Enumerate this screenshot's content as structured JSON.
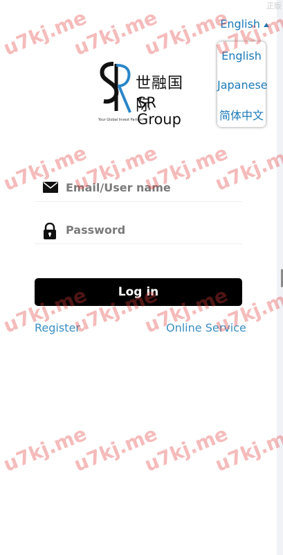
{
  "corner": {
    "text": "正版"
  },
  "language": {
    "current": "English",
    "options": [
      "English",
      "Japanese",
      "简体中文"
    ]
  },
  "logo": {
    "chinese_name": "世融国际",
    "english_name": "SR Group",
    "tagline": "Your Global Invest Partner",
    "mark_letters": "SR"
  },
  "form": {
    "email_placeholder": "Email/User name",
    "password_placeholder": "Password",
    "email_value": "",
    "password_value": "",
    "login_label": "Log in"
  },
  "links": {
    "register": "Register",
    "online_service": "Online Service"
  },
  "watermark": {
    "text": "u7kj.me"
  },
  "colors": {
    "link": "#1a79b8",
    "button": "#000000",
    "watermark": "#e23b3b"
  }
}
